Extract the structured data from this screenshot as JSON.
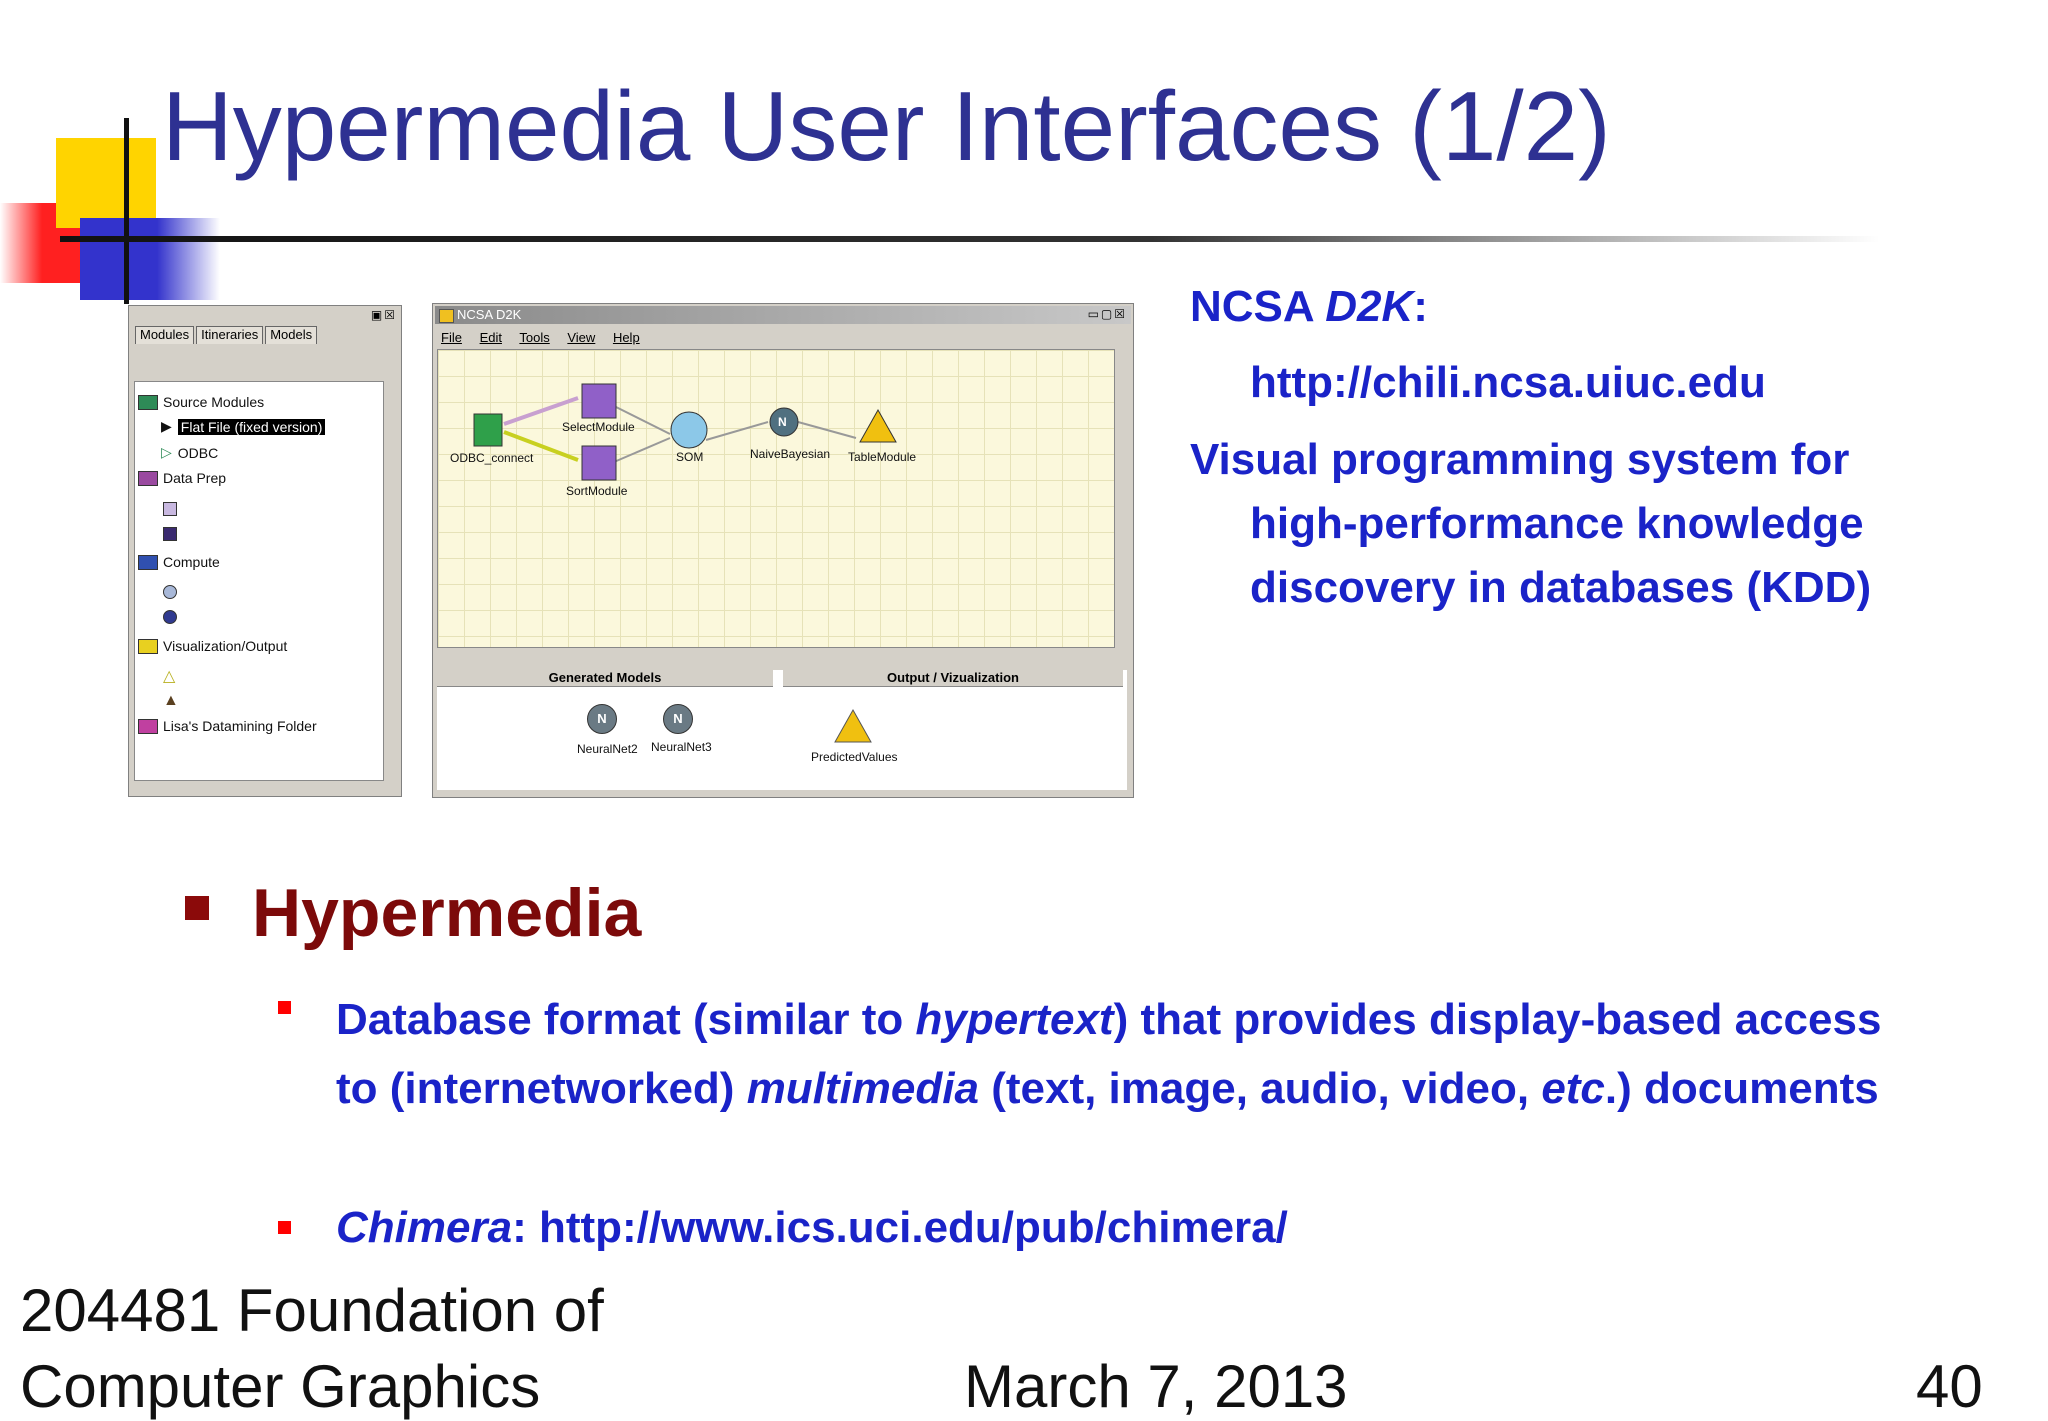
{
  "slide": {
    "title": "Hypermedia User Interfaces (1/2)",
    "accent_colors": {
      "title": "#2e3192",
      "body": "#1a23c8",
      "heading": "#7c0a0a",
      "bullet_sub": "#ff0000"
    }
  },
  "tree_panel": {
    "tabs": [
      "Modules",
      "Itineraries",
      "Models"
    ],
    "items": [
      "Source Modules",
      "Flat File (fixed version)",
      "ODBC",
      "Data Prep",
      "Compute",
      "Visualization/Output",
      "Lisa's Datamining Folder"
    ]
  },
  "d2k_window": {
    "title": "NCSA D2K",
    "menu": [
      "File",
      "Edit",
      "Tools",
      "View",
      "Help"
    ],
    "modules": [
      "ODBC_connect",
      "SelectModule",
      "SortModule",
      "SOM",
      "NaiveBayesian",
      "TableModule"
    ],
    "node_glyph": "N",
    "generated_models_label": "Generated Models",
    "output_label": "Output / Vizualization",
    "generated_models": [
      "NeuralNet2",
      "NeuralNet3"
    ],
    "outputs": [
      "PredictedValues"
    ]
  },
  "side": {
    "line1_a": "NCSA ",
    "line1_b": "D2K",
    "line1_c": ":",
    "url": "http://chili.ncsa.uiuc.edu",
    "desc1": "Visual programming system for",
    "desc2": "high-performance knowledge",
    "desc3": "discovery in databases (KDD)"
  },
  "bullets": {
    "heading": "Hypermedia",
    "p1_a": "Database format (similar to ",
    "p1_b": "hypertext",
    "p1_c": ") that provides display-based access to (internetworked) ",
    "p1_d": "multimedia",
    "p1_e": " (text, image, audio, video, ",
    "p1_f": "etc",
    "p1_g": ".) documents",
    "chimera_a": "Chimera",
    "chimera_b": ": ",
    "chimera_url": "http://www.ics.uci.edu/pub/chimera/"
  },
  "footer": {
    "course_1": "204481 Foundation of",
    "course_2": "Computer Graphics",
    "date": "March 7, 2013",
    "page": "40"
  }
}
